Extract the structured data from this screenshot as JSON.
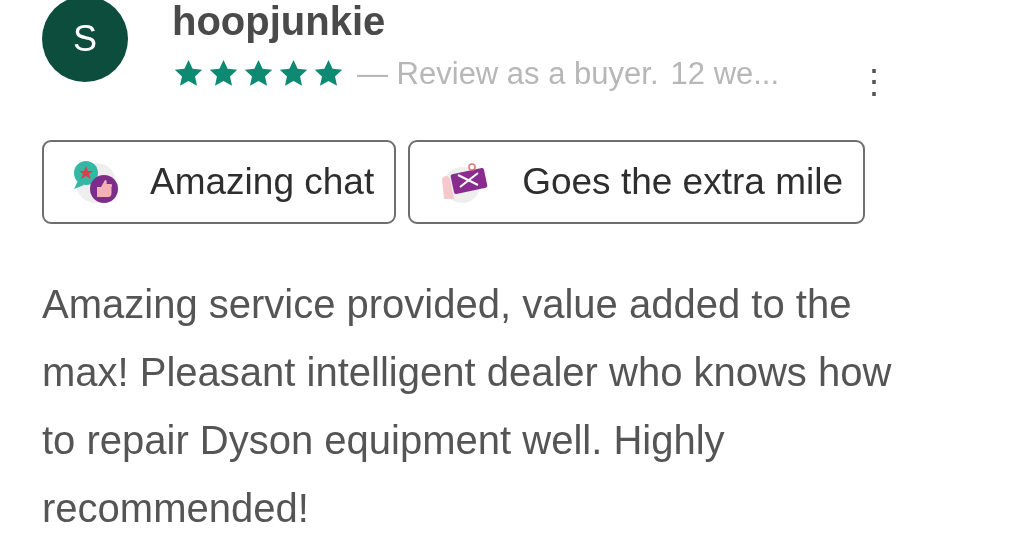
{
  "review": {
    "avatar": "S",
    "username": "hoopjunkie",
    "stars": 5,
    "meta": "— Review as a buyer.",
    "time": "12 we...",
    "menu": "⋮",
    "tags": [
      {
        "kind": "chat",
        "label": "Amazing chat"
      },
      {
        "kind": "ticket",
        "label": "Goes the extra mile"
      }
    ],
    "text": "Amazing service provided, value added to the max! Pleasant intelligent dealer who knows how to repair Dyson equipment well. Highly recommended!"
  }
}
